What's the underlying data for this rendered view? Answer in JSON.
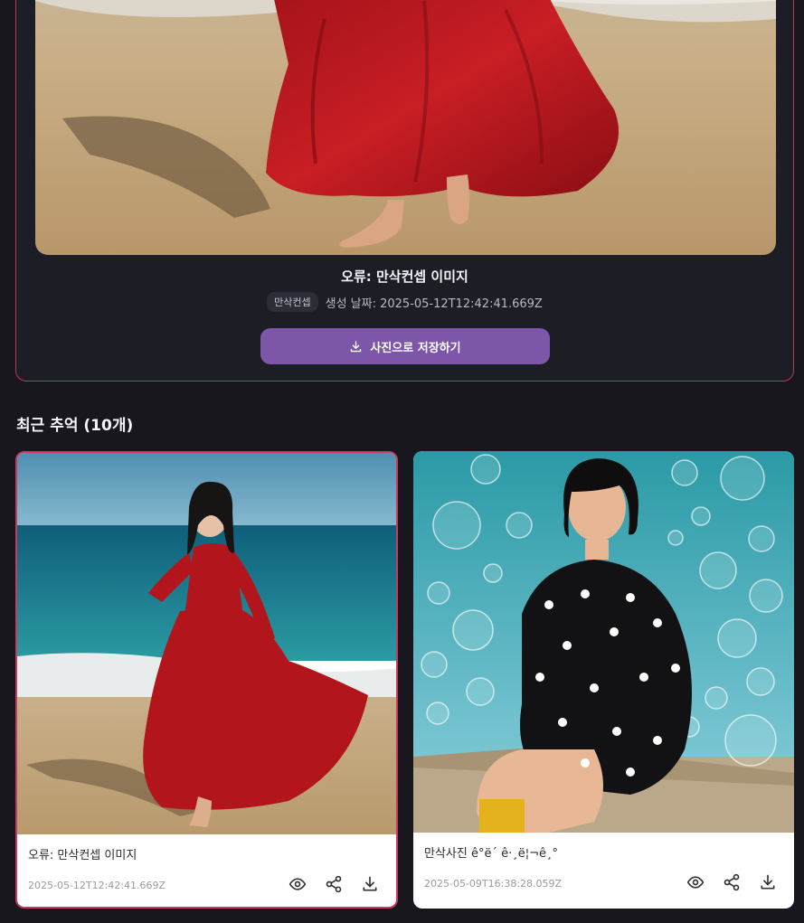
{
  "result": {
    "title": "오류: 만삭컨셉 이미지",
    "tag": "만삭컨셉",
    "created": "생성 날짜: 2025-05-12T12:42:41.669Z",
    "save_label": "사진으로 저장하기",
    "save_icon": "download-icon"
  },
  "recent": {
    "heading": "최근 추억 (10개)",
    "items": [
      {
        "caption": "오류: 만삭컨셉 이미지",
        "date": "2025-05-12T12:42:41.669Z",
        "actions": [
          "eye-icon",
          "share-icon",
          "download-icon"
        ]
      },
      {
        "caption": "만삭사진 ê°ë´ ê·¸ë¦¬ê¸°",
        "date": "2025-05-09T16:38:28.059Z",
        "actions": [
          "eye-icon",
          "share-icon",
          "download-icon"
        ]
      }
    ]
  },
  "colors": {
    "background": "#17171d",
    "accent": "#7d55a9",
    "border_highlight": "#c73b63"
  }
}
